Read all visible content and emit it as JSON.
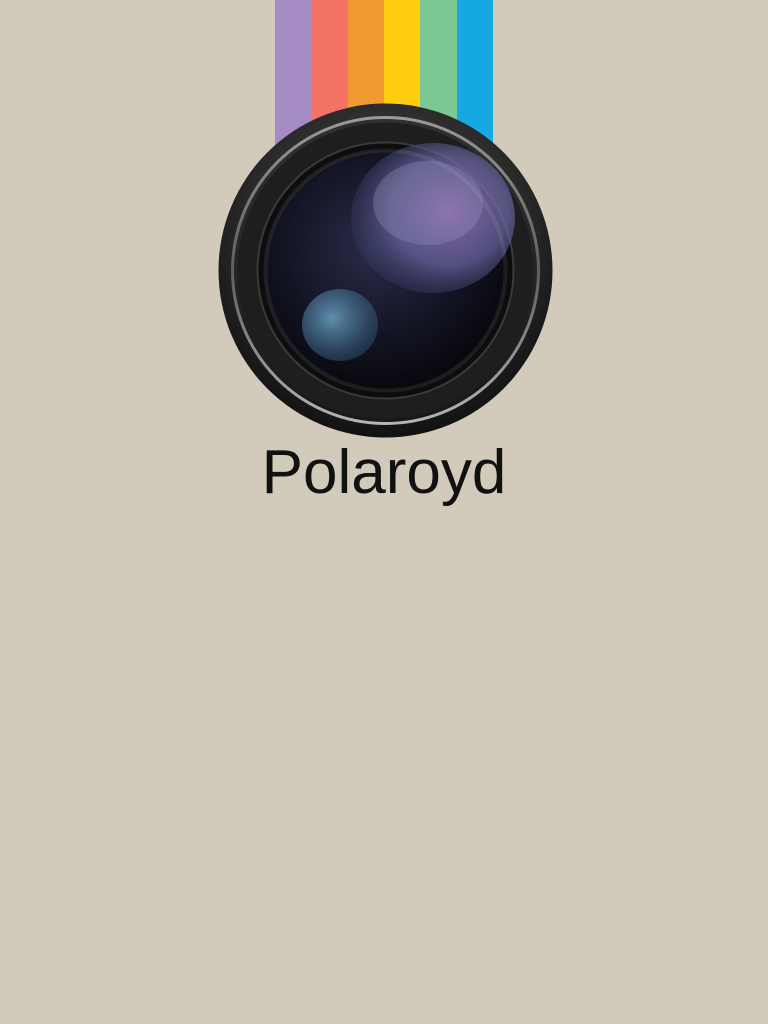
{
  "app": {
    "title": "Polaroyd"
  },
  "stripes": [
    {
      "name": "purple",
      "color": "#a58bc3"
    },
    {
      "name": "coral",
      "color": "#f47364"
    },
    {
      "name": "orange",
      "color": "#f09a32"
    },
    {
      "name": "yellow",
      "color": "#fecd0f"
    },
    {
      "name": "green",
      "color": "#7cc893"
    },
    {
      "name": "blue",
      "color": "#16a8e0"
    }
  ],
  "background_color": "#d2cbbb",
  "icons": {
    "logo": "camera-lens-icon"
  }
}
